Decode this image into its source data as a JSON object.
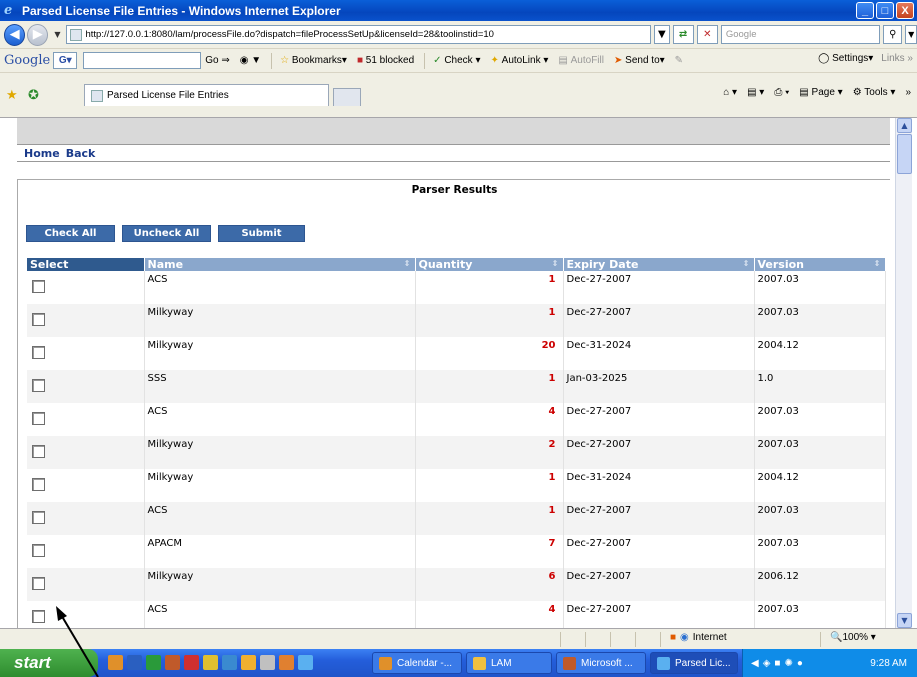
{
  "window": {
    "title": "Parsed License File Entries - Windows Internet Explorer",
    "minimize": "_",
    "maximize": "□",
    "close": "X"
  },
  "address": {
    "url": "http://127.0.0.1:8080/lam/processFile.do?dispatch=fileProcessSetUp&licenseId=28&toolinstid=10",
    "search_placeholder": "Google"
  },
  "google_toolbar": {
    "logo": "Google",
    "go": "Go",
    "bookmarks": "Bookmarks",
    "blocked": "51 blocked",
    "check": "Check",
    "autolink": "AutoLink",
    "autofill": "AutoFill",
    "sendto": "Send to",
    "settings": "Settings",
    "links": "Links"
  },
  "tab": {
    "label": "Parsed License File Entries",
    "page": "Page",
    "tools": "Tools"
  },
  "nav": {
    "home": "Home",
    "back": "Back"
  },
  "panel": {
    "title": "Parser Results",
    "check_all": "Check All",
    "uncheck_all": "Uncheck All",
    "submit": "Submit"
  },
  "table": {
    "headers": {
      "select": "Select",
      "name": "Name",
      "quantity": "Quantity",
      "expiry": "Expiry Date",
      "version": "Version"
    },
    "rows": [
      {
        "name": "ACS",
        "quantity": "1",
        "expiry": "Dec-27-2007",
        "version": "2007.03"
      },
      {
        "name": "Milkyway",
        "quantity": "1",
        "expiry": "Dec-27-2007",
        "version": "2007.03"
      },
      {
        "name": "Milkyway",
        "quantity": "20",
        "expiry": "Dec-31-2024",
        "version": "2004.12"
      },
      {
        "name": "SSS",
        "quantity": "1",
        "expiry": "Jan-03-2025",
        "version": "1.0"
      },
      {
        "name": "ACS",
        "quantity": "4",
        "expiry": "Dec-27-2007",
        "version": "2007.03"
      },
      {
        "name": "Milkyway",
        "quantity": "2",
        "expiry": "Dec-27-2007",
        "version": "2007.03"
      },
      {
        "name": "Milkyway",
        "quantity": "1",
        "expiry": "Dec-31-2024",
        "version": "2004.12"
      },
      {
        "name": "ACS",
        "quantity": "1",
        "expiry": "Dec-27-2007",
        "version": "2007.03"
      },
      {
        "name": "APACM",
        "quantity": "7",
        "expiry": "Dec-27-2007",
        "version": "2007.03"
      },
      {
        "name": "Milkyway",
        "quantity": "6",
        "expiry": "Dec-27-2007",
        "version": "2006.12"
      },
      {
        "name": "ACS",
        "quantity": "4",
        "expiry": "Dec-27-2007",
        "version": "2007.03"
      }
    ]
  },
  "status": {
    "zone": "Internet",
    "zoom": "100%"
  },
  "taskbar": {
    "start": "start",
    "items": [
      "Calendar -...",
      "LAM",
      "Microsoft ...",
      "Parsed Lic..."
    ],
    "clock": "9:28 AM"
  },
  "colors": {
    "title_blue": "#0546bd",
    "button_blue": "#3c6aa8",
    "header_blue": "#8aa7cc",
    "select_header": "#2f5a8e",
    "quantity_red": "#cc0000",
    "link_blue": "#1a3a8a"
  }
}
